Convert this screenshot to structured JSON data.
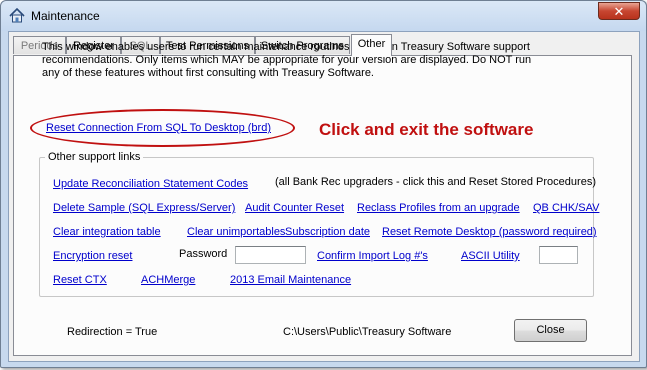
{
  "window": {
    "title": "Maintenance",
    "close_glyph": "✕"
  },
  "tabs": [
    "Periods",
    "Register",
    "SQL",
    "Test Permissions",
    "Switch Programs",
    "Other"
  ],
  "active_tab": "Other",
  "intro_text": "This window enables users to run certain maintenance routines based on Treasury Software support recommendations.  Only items which MAY be appropriate for your version are displayed.  Do NOT run any of these features without first consulting with Treasury Software.",
  "reset_link": "Reset Connection From SQL To Desktop (brd)",
  "callout": {
    "text": "Click and exit the software",
    "color": "#c01010"
  },
  "group": {
    "legend": "Other support links",
    "update_link": "Update Reconciliation Statement Codes",
    "update_note": "(all Bank Rec upgraders - click this and Reset Stored Procedures)",
    "row2": [
      "Delete Sample (SQL Express/Server)",
      "Audit Counter Reset",
      "Reclass Profiles from an upgrade",
      "QB CHK/SAV"
    ],
    "row3": [
      "Clear integration table",
      "Clear unimportables",
      "Subscription date",
      "Reset Remote Desktop (password required)"
    ],
    "encryption_link": "Encryption reset",
    "password_label": "Password",
    "password_value": "",
    "confirm_link": "Confirm Import Log #'s",
    "ascii_link": "ASCII Utility",
    "ascii_value": "",
    "row5": [
      "Reset CTX",
      "ACHMerge",
      "2013 Email Maintenance"
    ]
  },
  "footer": {
    "redirection": "Redirection = True",
    "path": "C:\\Users\\Public\\Treasury Software",
    "close_button": "Close"
  },
  "colors": {
    "link": "#0000cc",
    "title_bar": "#c5d8ef",
    "close": "#c74631"
  },
  "icons": [
    "app-home-icon",
    "close-icon"
  ]
}
